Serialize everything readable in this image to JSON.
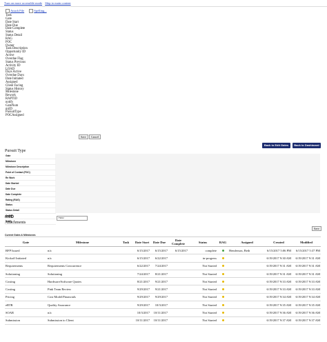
{
  "top_links": [
    "Turn on more accessible mode",
    "Skip to main content"
  ],
  "actions": [
    {
      "icon": "paperclip-icon",
      "label": "Attach File"
    },
    {
      "icon": "abc-check-icon",
      "label": "Spelling..."
    }
  ],
  "field_list": [
    "Task",
    "Gate",
    "Date Start",
    "Date Due",
    "Date Complete",
    "Status",
    "Status Detail",
    "RAG",
    "POC",
    "Owner",
    "Task Description",
    "Opportunity ID",
    "Active",
    "Overdue Flag",
    "Status Previous",
    "Activity ID",
    "LOAD",
    "Days Active",
    "Overdue Days",
    "Date Initiated",
    "Assigned",
    "Client Facing",
    "Status History",
    "Milestone",
    "Rework",
    "RAPTID",
    "notify",
    "GateNum",
    "miID",
    "PursuitType",
    "POCAssigned"
  ],
  "buttons": {
    "save": "Save",
    "cancel": "Cancel",
    "edit_gates": "Back to Edit Gates",
    "dashboard": "Back to Dashboard",
    "save2": "Save"
  },
  "form": {
    "section_title": "Pursuit Type",
    "fields": [
      "Gate",
      "Milestone",
      "Milestone Description",
      "Point of Contact (POC)",
      "Re Work",
      "Date Started",
      "Date Due",
      "Date Complete",
      "Rating (RAG)",
      "Status",
      "Status Detail",
      "Owner",
      "Notify"
    ],
    "miid_label": "miID",
    "miid_value": "73062",
    "attachments_label": "Attachments"
  },
  "gates": {
    "title": "Current Gates & Milestones",
    "headers": [
      "Gate",
      "Milestone",
      "Task",
      "Date Start",
      "Date Due",
      "Date Complete",
      "Status",
      "RAG",
      "Assigned",
      "Created",
      "Modified"
    ],
    "rows": [
      [
        "RFP Issued",
        "n/a",
        "",
        "6/15/2017",
        "6/15/2017",
        "6/15/2017",
        "complete",
        "g",
        "Henderson, Beth",
        "6/15/2017 5:06 PM",
        "6/15/2017 5:37 PM"
      ],
      [
        "Kickoff Initiated",
        "n/a",
        "",
        "6/15/2017",
        "6/22/2017",
        "",
        "in-progress",
        "y",
        "",
        "6/19/2017 9:30 AM",
        "6/19/2017 9:31 AM"
      ],
      [
        "Requirements",
        "Requirements Concurrence",
        "",
        "6/22/2017",
        "7/24/2017",
        "",
        "Not Started",
        "y",
        "",
        "6/19/2017 9:31 AM",
        "6/19/2017 9:31 AM"
      ],
      [
        "Solutioning",
        "Solutioning",
        "",
        "7/24/2017",
        "8/21/2017",
        "",
        "Not Started",
        "y",
        "",
        "6/19/2017 9:31 AM",
        "6/19/2017 9:31 AM"
      ],
      [
        "Costing",
        "Hardware/Software Quotes",
        "",
        "8/21/2017",
        "9/21/2017",
        "",
        "Not Started",
        "y",
        "",
        "6/19/2017 9:33 AM",
        "6/19/2017 9:33 AM"
      ],
      [
        "Costing",
        "Pink Team Review",
        "",
        "9/29/2017",
        "9/21/2017",
        "",
        "Not Started",
        "y",
        "",
        "6/19/2017 9:33 AM",
        "6/19/2017 9:33 AM"
      ],
      [
        "Pricing",
        "Cost Model/Financials",
        "",
        "9/29/2017",
        "9/29/2017",
        "",
        "Not Started",
        "y",
        "",
        "6/19/2017 9:34 AM",
        "6/19/2017 9:34 AM"
      ],
      [
        "eRTR",
        "Quality Assurance",
        "",
        "9/29/2017",
        "10/3/2017",
        "",
        "Not Started",
        "y",
        "",
        "6/19/2017 9:35 AM",
        "6/19/2017 9:35 AM"
      ],
      [
        "SOAR",
        "n/a",
        "",
        "10/3/2017",
        "10/11/2017",
        "",
        "Not Started",
        "y",
        "",
        "6/19/2017 9:36 AM",
        "6/19/2017 9:36 AM"
      ],
      [
        "Submission",
        "Submission to Client",
        "",
        "10/11/2017",
        "10/11/2017",
        "",
        "Not Started",
        "y",
        "",
        "6/19/2017 9:37 AM",
        "6/19/2017 9:37 AM"
      ]
    ]
  },
  "colors": {
    "navy": "#1d2d6f",
    "link": "#1a3dbd",
    "rag_green": "#43a047",
    "rag_yellow": "#e6b800"
  }
}
